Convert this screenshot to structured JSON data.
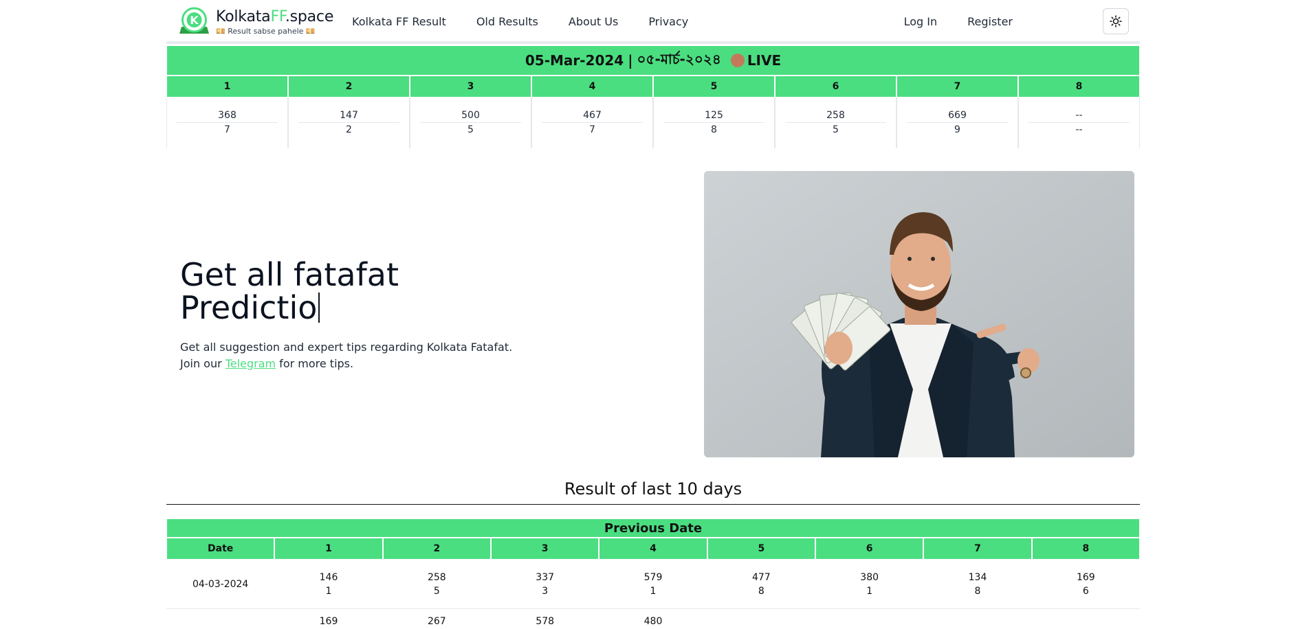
{
  "header": {
    "brand_prefix": "Kolkata",
    "brand_ff": "FF",
    "brand_suffix": ".space",
    "tagline": "💴 Result sabse pahele 💴",
    "nav": [
      "Kolkata FF Result",
      "Old Results",
      "About Us",
      "Privacy"
    ],
    "login": "Log In",
    "register": "Register",
    "theme_icon": "sun-icon"
  },
  "live": {
    "date_en": "05-Mar-2024",
    "separator": "|",
    "date_bn": "০৫-মার্চ-২০২৪",
    "live_label": "LIVE",
    "heads": [
      "1",
      "2",
      "3",
      "4",
      "5",
      "6",
      "7",
      "8"
    ],
    "patti": [
      "368",
      "147",
      "500",
      "467",
      "125",
      "258",
      "669",
      "--"
    ],
    "single": [
      "7",
      "2",
      "5",
      "7",
      "8",
      "5",
      "9",
      "--"
    ]
  },
  "hero": {
    "title_line1": "Get all fatafat",
    "title_line2": "Predictio",
    "desc_line1": "Get all suggestion and expert tips regarding Kolkata Fatafat.",
    "join_prefix": "Join our ",
    "telegram": "Telegram",
    "join_suffix": " for more tips."
  },
  "results": {
    "title": "Result of last 10 days",
    "prev_title": "Previous Date",
    "heads": [
      "Date",
      "1",
      "2",
      "3",
      "4",
      "5",
      "6",
      "7",
      "8"
    ],
    "row1": {
      "date": "04-03-2024",
      "patti": [
        "146",
        "258",
        "337",
        "579",
        "477",
        "380",
        "134",
        "169"
      ],
      "single": [
        "1",
        "5",
        "3",
        "1",
        "8",
        "1",
        "8",
        "6"
      ]
    },
    "row2_partial": [
      "169",
      "267",
      "578",
      "480"
    ]
  },
  "colors": {
    "accent": "#4ade80",
    "live_dot": "#c47a5a"
  }
}
